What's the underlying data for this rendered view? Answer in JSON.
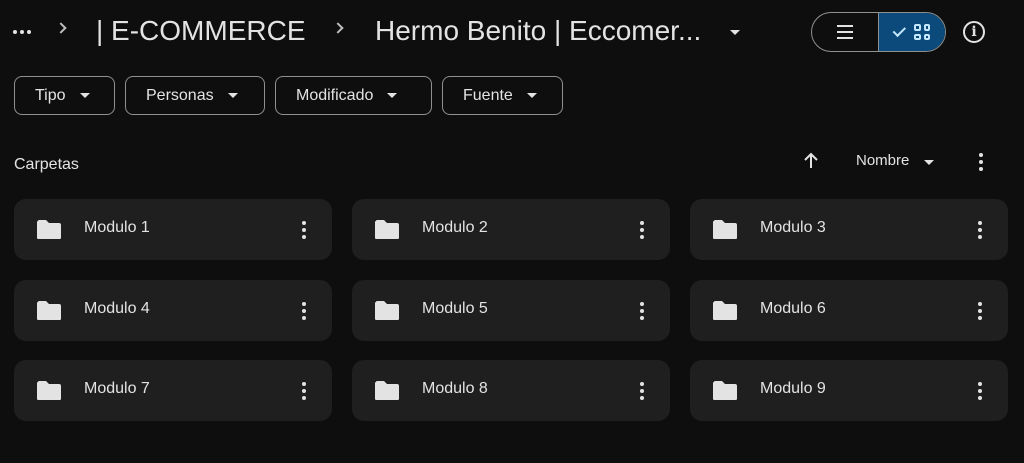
{
  "breadcrumb": {
    "parent": "| E-COMMERCE",
    "current": "Hermo Benito | Eccomer..."
  },
  "filters": [
    {
      "label": "Tipo"
    },
    {
      "label": "Personas"
    },
    {
      "label": "Modificado"
    },
    {
      "label": "Fuente"
    }
  ],
  "section": {
    "title": "Carpetas",
    "sort_label": "Nombre"
  },
  "folders": [
    {
      "name": "Modulo 1"
    },
    {
      "name": "Modulo 2"
    },
    {
      "name": "Modulo 3"
    },
    {
      "name": "Modulo 4"
    },
    {
      "name": "Modulo 5"
    },
    {
      "name": "Modulo 6"
    },
    {
      "name": "Modulo 7"
    },
    {
      "name": "Modulo 8"
    },
    {
      "name": "Modulo 9"
    }
  ],
  "colors": {
    "background": "#0e0e0e",
    "card": "#1f1f1f",
    "accent": "#0b4a7a",
    "text": "#e3e3e3"
  },
  "icons": [
    "more-icon",
    "chevron-right-icon",
    "dropdown-icon",
    "list-view-icon",
    "check-icon",
    "grid-view-icon",
    "info-icon",
    "sort-arrow-icon",
    "folder-icon",
    "more-vert-icon"
  ]
}
